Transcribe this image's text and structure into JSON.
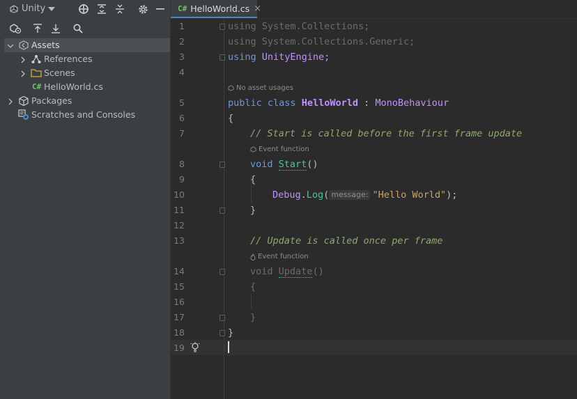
{
  "explorer": {
    "project_selector": "Unity",
    "tree": [
      {
        "label": "Assets",
        "expanded": true,
        "selected": true
      },
      {
        "label": "References",
        "expanded": false
      },
      {
        "label": "Scenes",
        "expanded": false
      },
      {
        "label": "HelloWorld.cs",
        "file_badge": "C#"
      },
      {
        "label": "Packages",
        "expanded": false
      },
      {
        "label": "Scratches and Consoles"
      }
    ]
  },
  "editor": {
    "tab": {
      "badge": "C#",
      "label": "HelloWorld.cs"
    },
    "hints": {
      "no_asset_usages": "No asset usages",
      "event_function_1": "Event function",
      "event_function_2": "Event function",
      "param_name": "message:"
    },
    "line_numbers": [
      "1",
      "2",
      "3",
      "4",
      "5",
      "6",
      "7",
      "8",
      "9",
      "10",
      "11",
      "12",
      "13",
      "14",
      "15",
      "16",
      "17",
      "18",
      "19"
    ],
    "code": {
      "l1_kw": "using",
      "l1_ns": "System.Collections;",
      "l2_kw": "using",
      "l2_ns": "System.Collections.Generic;",
      "l3_kw": "using",
      "l3_ns": "UnityEngine;",
      "l5_public": "public",
      "l5_class": "class",
      "l5_name": "HelloWorld",
      "l5_colon": ":",
      "l5_base": "MonoBehaviour",
      "l6": "{",
      "l7": "// Start is called before the first frame update",
      "l8_kw": "void",
      "l8_name": "Start",
      "l8_paren": "()",
      "l9": "{",
      "l10_obj": "Debug",
      "l10_dot": ".",
      "l10_fn": "Log",
      "l10_open": "(",
      "l10_str": "\"Hello World\"",
      "l10_close": ");",
      "l11": "}",
      "l13": "// Update is called once per frame",
      "l14_kw": "void",
      "l14_name": "Update",
      "l14_paren": "()",
      "l15": "{",
      "l17": "}",
      "l18": "}"
    }
  },
  "colors": {
    "keyword": "#6c95eb",
    "class_name": "#c191ff",
    "method_name": "#39cc9b",
    "string": "#c9a26d",
    "comment": "#85c46c",
    "accent": "#4a88c7"
  }
}
